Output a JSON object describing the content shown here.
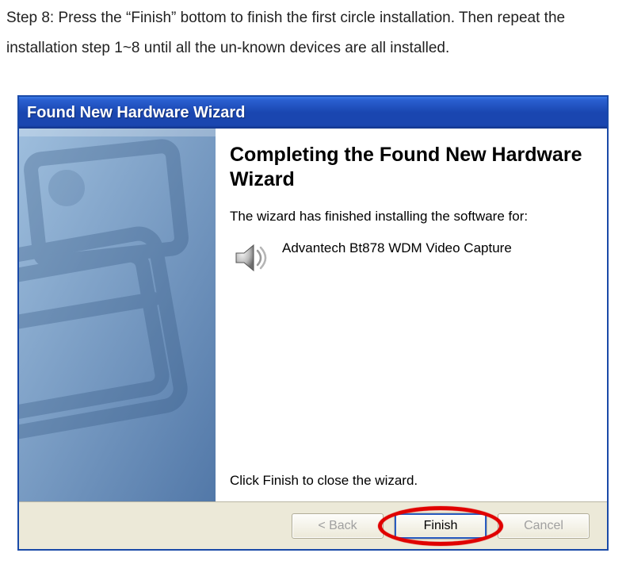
{
  "instruction": "Step 8: Press the “Finish” bottom to finish the first circle installation. Then repeat the installation step 1~8 until all the un-known devices are all installed.",
  "dialog": {
    "title": "Found New Hardware Wizard",
    "heading": "Completing the Found New Hardware Wizard",
    "finished_text": "The wizard has finished installing the software for:",
    "device_name": "Advantech Bt878 WDM Video Capture",
    "close_text": "Click Finish to close the wizard.",
    "buttons": {
      "back": "< Back",
      "finish": "Finish",
      "cancel": "Cancel"
    }
  }
}
